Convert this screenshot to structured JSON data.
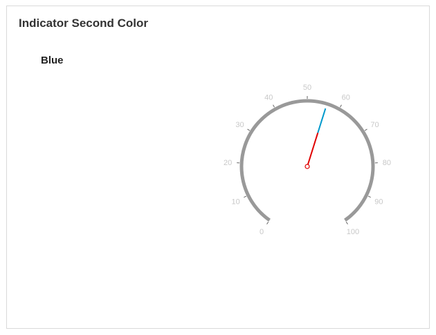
{
  "panel": {
    "title": "Indicator Second Color",
    "option_label": "Blue"
  },
  "gauge": {
    "min": 0,
    "max": 100,
    "start_angle_deg": 215,
    "end_angle_deg": 505,
    "pointer_value": 56,
    "tick_labels": [
      "0",
      "10",
      "20",
      "30",
      "40",
      "50",
      "60",
      "70",
      "80",
      "90",
      "100"
    ],
    "colors": {
      "scale": "#999999",
      "tick_text": "#c8c8c8",
      "pointer_primary": "#e00000",
      "pointer_second": "#0099cc"
    }
  }
}
